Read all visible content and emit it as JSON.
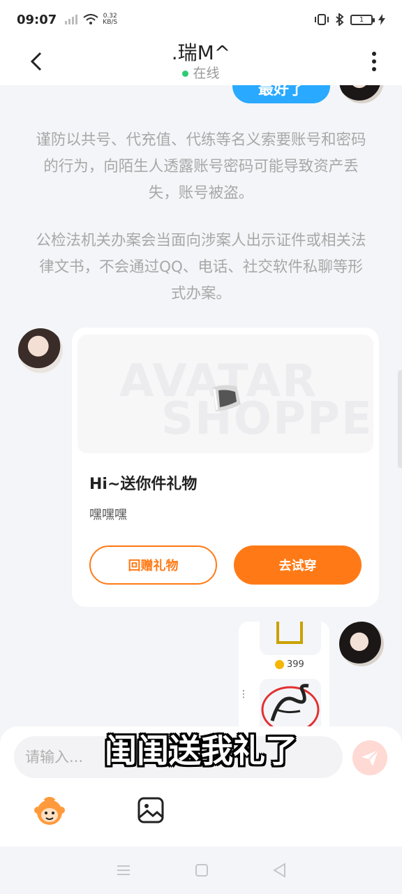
{
  "status_bar": {
    "time": "09:07",
    "net_speed": "0.32",
    "net_unit": "KB/S",
    "battery": "1"
  },
  "header": {
    "title": ".瑞M^",
    "status": "在线"
  },
  "chat": {
    "partial_bubble": "最好了",
    "notice_1": "谨防以共号、代充值、代练等名义索要账号和密码的行为，向陌生人透露账号密码可能导致资产丢失，账号被盗。",
    "notice_2": "公检法机关办案会当面向涉案人出示证件或相关法律文书，不会通过QQ、电话、社交软件私聊等形式办案。",
    "gift_card": {
      "watermark_1": "AVATAR",
      "watermark_2": "SHOPPE",
      "title": "Hi~送你件礼物",
      "subtitle": "嘿嘿嘿",
      "return_label": "回赠礼物",
      "try_label": "去试穿"
    },
    "shop_card": {
      "price": "399"
    }
  },
  "input": {
    "placeholder": "请输入..."
  },
  "subtitle_overlay": "闺闺送我礼了",
  "colors": {
    "accent": "#ff7a16",
    "bubble": "#29a9ff",
    "online": "#2ecc71"
  }
}
